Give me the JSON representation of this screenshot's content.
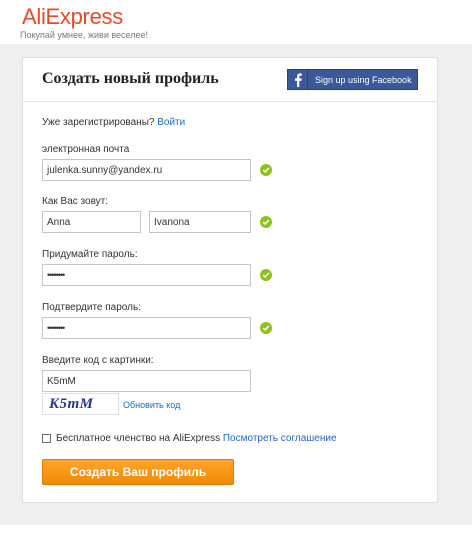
{
  "brand": {
    "logo": "AliExpress",
    "tagline": "Покупай умнее, живи веселее!"
  },
  "form": {
    "title": "Создать новый профиль",
    "facebook_button": "Sign up using Facebook",
    "already_registered": "Уже зарегистрированы?",
    "login_link": "Войти",
    "email_label": "электронная почта",
    "email_value": "julenka.sunny@yandex.ru",
    "name_label": "Как Вас зовут:",
    "first_name_value": "Anna",
    "last_name_value": "Ivanona",
    "password_label": "Придумайте пароль:",
    "password_value": "••••••••",
    "confirm_label": "Подтвердите пароль:",
    "confirm_value": "••••••••",
    "captcha_label": "Введите код с картинки:",
    "captcha_value": "K5mM",
    "captcha_image_text": "K5mM",
    "refresh_code": "Обновить код",
    "membership_text": "Бесплатное членство на AliExpress",
    "agreement_link": "Посмотреть соглашение",
    "submit": "Создать Ваш профиль"
  },
  "colors": {
    "brand": "#e8492b",
    "facebook": "#3b5998",
    "valid": "#8dc21f",
    "cta": "#f5961a",
    "link": "#1f66c4"
  }
}
